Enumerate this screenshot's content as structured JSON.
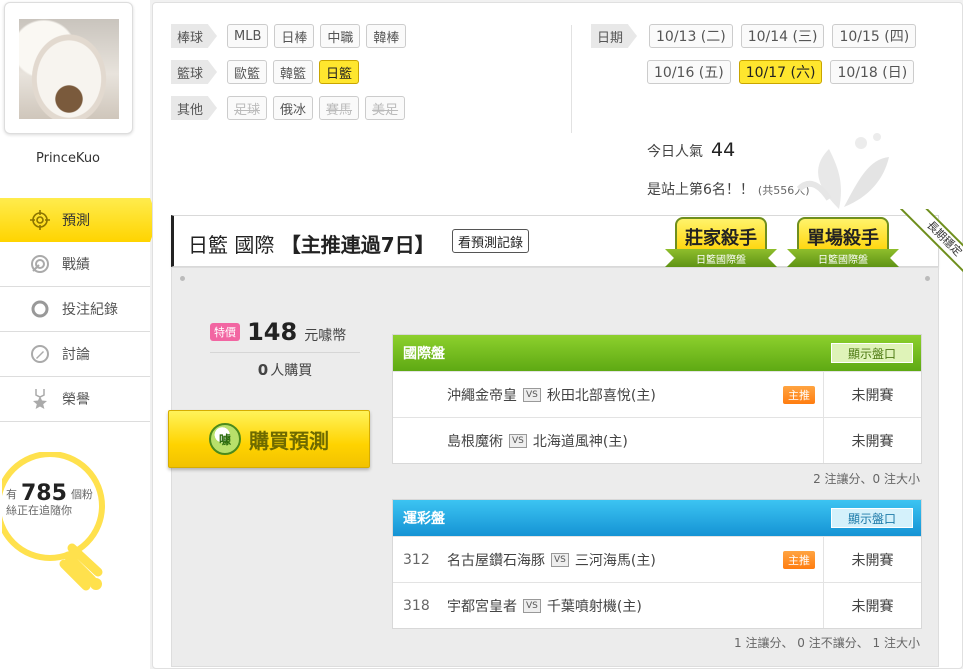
{
  "profile": {
    "username": "PrinceKuo"
  },
  "nav": [
    {
      "label": "預測",
      "icon": "target-icon",
      "active": true
    },
    {
      "label": "戰績",
      "icon": "record-icon",
      "active": false
    },
    {
      "label": "投注紀錄",
      "icon": "circle-icon",
      "active": false
    },
    {
      "label": "討論",
      "icon": "discuss-icon",
      "active": false
    },
    {
      "label": "榮譽",
      "icon": "honor-icon",
      "active": false
    }
  ],
  "fans": {
    "prefix": "有",
    "count": "785",
    "unit": "個粉",
    "line2": "絲正在追隨你"
  },
  "filters": {
    "baseball": {
      "label": "棒球",
      "items": [
        "MLB",
        "日棒",
        "中職",
        "韓棒"
      ]
    },
    "basketball": {
      "label": "籃球",
      "items": [
        "歐籃",
        "韓籃",
        "日籃"
      ],
      "selected": "日籃"
    },
    "other": {
      "label": "其他",
      "items": [
        "足球",
        "俄冰",
        "賽馬",
        "美足"
      ]
    }
  },
  "dates": {
    "label": "日期",
    "row1": [
      "10/13 (二)",
      "10/14 (三)",
      "10/15 (四)"
    ],
    "row2": [
      "10/16 (五)",
      "10/17 (六)",
      "10/18 (日)"
    ],
    "selected": "10/17 (六)"
  },
  "stats": {
    "popularity_label": "今日人氣",
    "popularity_value": "44",
    "rank_text": "是站上第6名！！",
    "rank_total": "(共556人)"
  },
  "header": {
    "league": "日籃 國際",
    "streak": "【主推連過7日】",
    "history_button": "看預測記錄",
    "badge1_title": "莊家殺手",
    "badge1_sub": "日籃國際盤",
    "badge2_title": "單場殺手",
    "badge2_sub": "日籃國際盤",
    "corner_ribbon": "長期穩定"
  },
  "purchase": {
    "special_tag": "特價",
    "price": "148",
    "unit": "元噱幣",
    "buyers_count": "0",
    "buyers_label": "人購買",
    "buy_button": "購買預測",
    "coin_icon_text": "噱"
  },
  "international": {
    "title": "國際盤",
    "show_button": "顯示盤口",
    "rows": [
      {
        "code": "",
        "home": "沖繩金帝皇",
        "away": "秋田北部喜悅(主)",
        "tag": "主推",
        "status": "未開賽"
      },
      {
        "code": "",
        "home": "島根魔術",
        "away": "北海道風神(主)",
        "tag": "",
        "status": "未開賽"
      }
    ],
    "summary": "2 注讓分、0 注大小"
  },
  "lottery": {
    "title": "運彩盤",
    "show_button": "顯示盤口",
    "rows": [
      {
        "code": "312",
        "home": "名古屋鑽石海豚",
        "away": "三河海馬(主)",
        "tag": "主推",
        "status": "未開賽"
      },
      {
        "code": "318",
        "home": "宇都宮皇者",
        "away": "千葉噴射機(主)",
        "tag": "",
        "status": "未開賽"
      }
    ],
    "summary": "1 注讓分、 0 注不讓分、 1 注大小"
  },
  "vs_label": "VS"
}
